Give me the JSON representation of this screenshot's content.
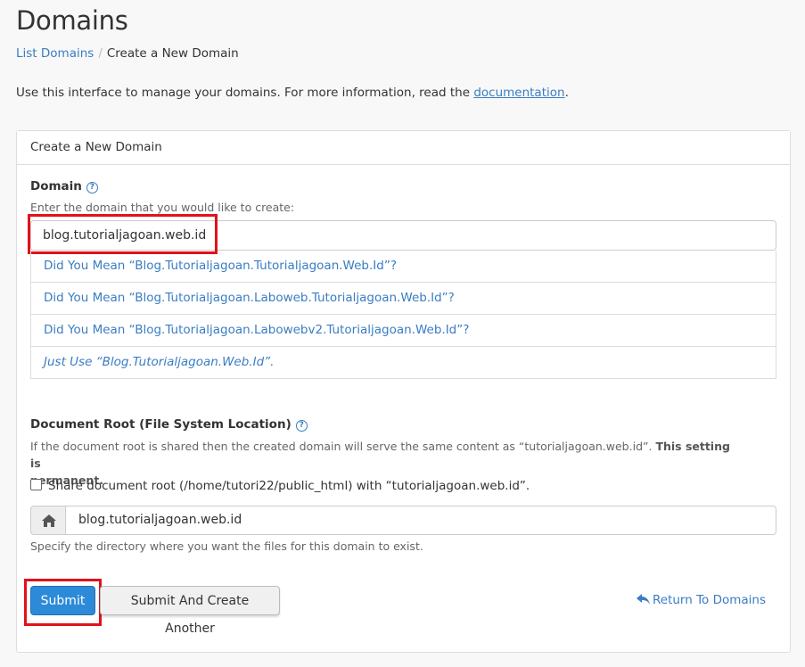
{
  "page": {
    "title": "Domains"
  },
  "breadcrumb": {
    "parent": "List Domains",
    "separator": "/",
    "current": "Create a New Domain"
  },
  "intro": {
    "text": "Use this interface to manage your domains. For more information, read the ",
    "link": "documentation",
    "suffix": "."
  },
  "panel": {
    "heading": "Create a New Domain"
  },
  "domain": {
    "label": "Domain",
    "help": "Enter the domain that you would like to create:",
    "value": "blog.tutorialjagoan.web.id",
    "suggestions": [
      "Did You Mean “Blog.Tutorialjagoan.Tutorialjagoan.Web.Id”?",
      "Did You Mean “Blog.Tutorialjagoan.Laboweb.Tutorialjagoan.Web.Id”?",
      "Did You Mean “Blog.Tutorialjagoan.Labowebv2.Tutorialjagoan.Web.Id”?",
      "Just Use “Blog.Tutorialjagoan.Web.Id”."
    ]
  },
  "docroot": {
    "label": "Document Root (File System Location)",
    "help_text": "If the document root is shared then the created domain will serve the same content as “tutorialjagoan.web.id”. ",
    "help_strong_1": "This setting is",
    "help_strong_2": "permanent.",
    "share_label": "Share document root (/home/tutori22/public_html) with “tutorialjagoan.web.id”.",
    "share_checked": false,
    "value": "blog.tutorialjagoan.web.id",
    "hint": "Specify the directory where you want the files for this domain to exist."
  },
  "actions": {
    "submit": "Submit",
    "submit_another": "Submit And Create Another",
    "return": "Return To Domains"
  },
  "colors": {
    "link": "#3a7dc3",
    "primary": "#2d8ad8",
    "highlight": "#e0121c"
  }
}
